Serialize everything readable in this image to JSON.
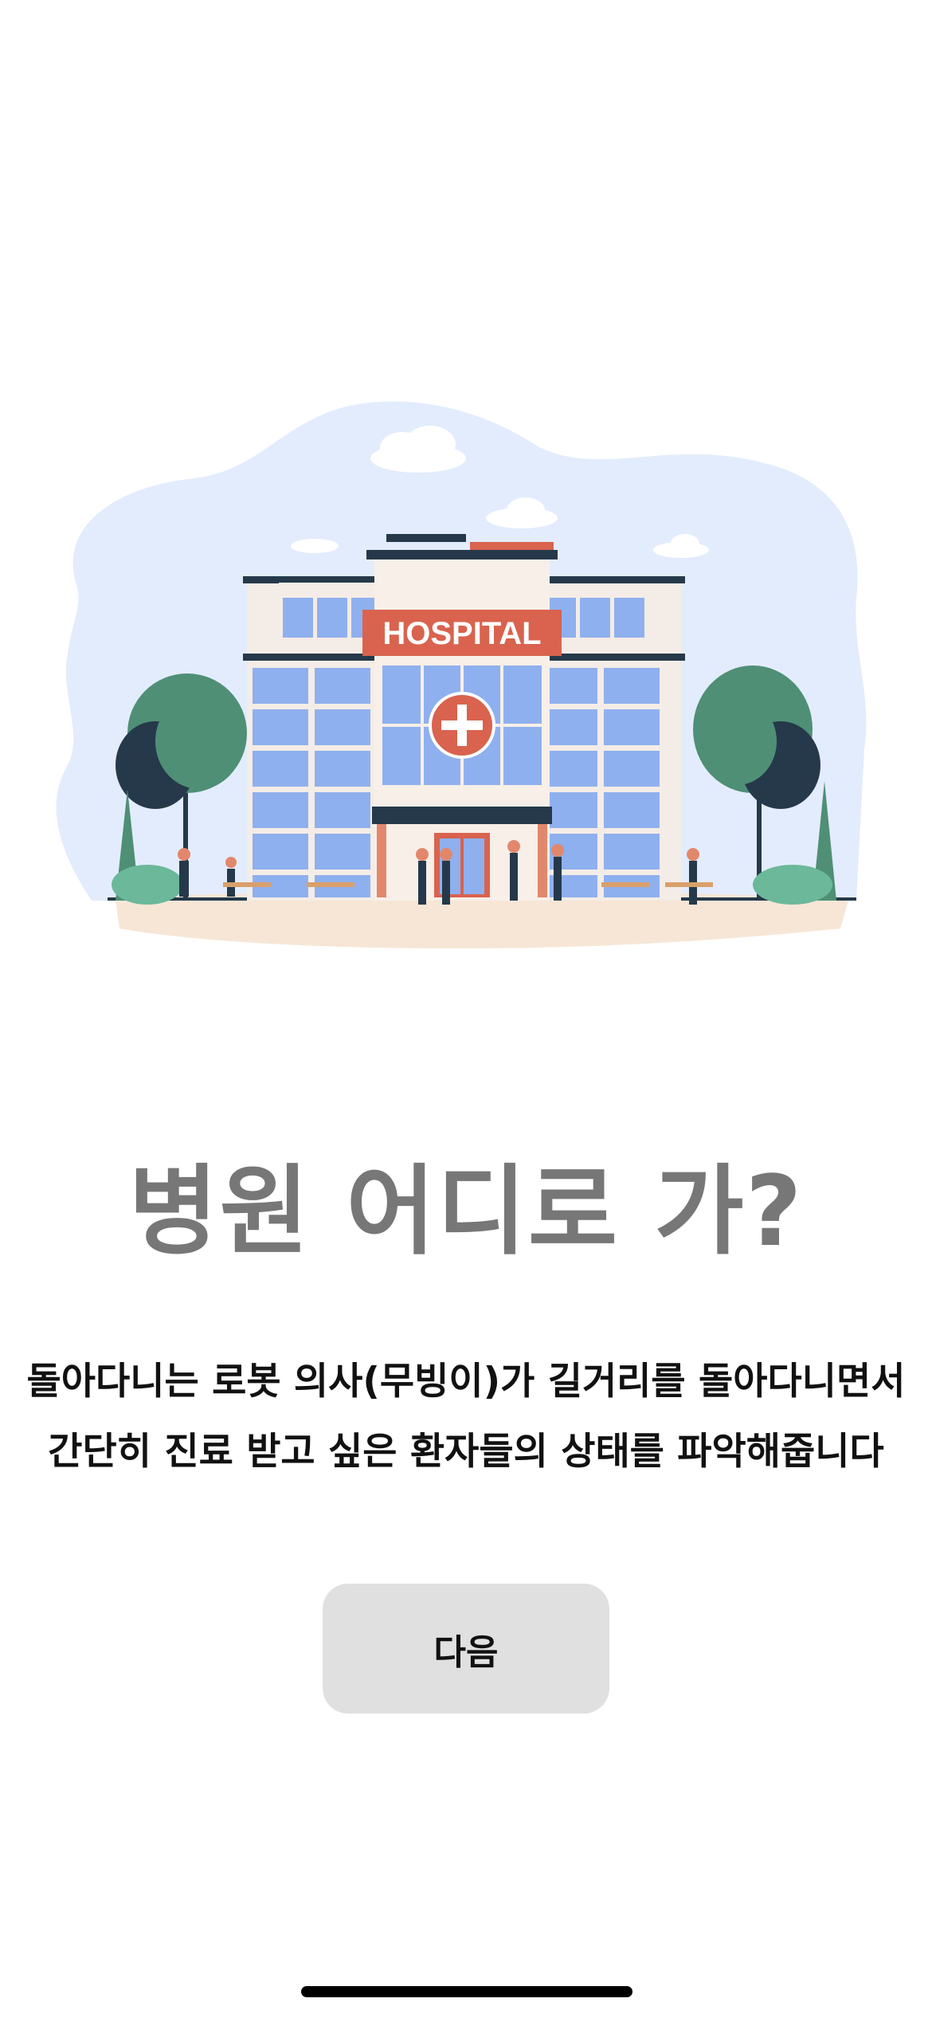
{
  "illustration": {
    "sign_text": "HOSPITAL",
    "icon": "hospital-building-illustration"
  },
  "title": "병원 어디로 가?",
  "description": {
    "line1": "돌아다니는 로봇 의사(무빙이)가 길거리를 돌아다니면서",
    "line2": "간단히 진료 받고 싶은 환자들의 상태를 파악해줍니다"
  },
  "next_button": {
    "label": "다음"
  },
  "colors": {
    "title": "#777777",
    "text": "#111111",
    "button_bg": "#e0e0e0",
    "sign": "#d9634e",
    "sky": "#e3ecfc",
    "window": "#8fb0ee",
    "tree": "#4f8f76"
  }
}
